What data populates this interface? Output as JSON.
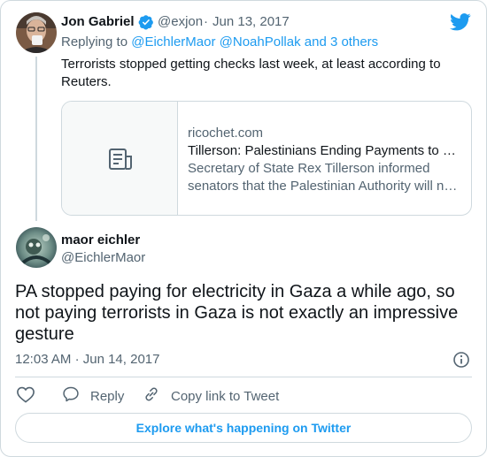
{
  "colors": {
    "accent": "#1d9bf0",
    "text": "#0f1419",
    "muted": "#536471",
    "border": "#cfd9de"
  },
  "parent_tweet": {
    "author_name": "Jon Gabriel",
    "verified_icon": "verified-badge-icon",
    "handle": "@exjon",
    "separator": "·",
    "date": "Jun 13, 2017",
    "replying_prefix": "Replying to",
    "replying_users": "@EichlerMaor @NoahPollak",
    "replying_suffix": "and 3 others",
    "text": "Terrorists stopped getting checks last week, at least according to Reuters.",
    "link_card": {
      "icon": "article-icon",
      "domain": "ricochet.com",
      "title": "Tillerson: Palestinians Ending Payments to …",
      "description_line1": "Secretary of State Rex Tillerson informed",
      "description_line2": "senators that the Palestinian Authority will n…"
    }
  },
  "tweet": {
    "author_name": "maor eichler",
    "handle": "@EichlerMaor",
    "text": "PA stopped paying for electricity in Gaza a while ago, so not paying terrorists in Gaza is not exactly an impressive gesture",
    "time": "12:03 AM",
    "separator": "·",
    "date": "Jun 14, 2017",
    "info_icon": "info-icon"
  },
  "actions": {
    "like_icon": "heart-icon",
    "reply_label": "Reply",
    "copy_link_label": "Copy link to Tweet"
  },
  "footer": {
    "explore_label": "Explore what's happening on Twitter"
  },
  "brand_icon": "twitter-bird-icon"
}
